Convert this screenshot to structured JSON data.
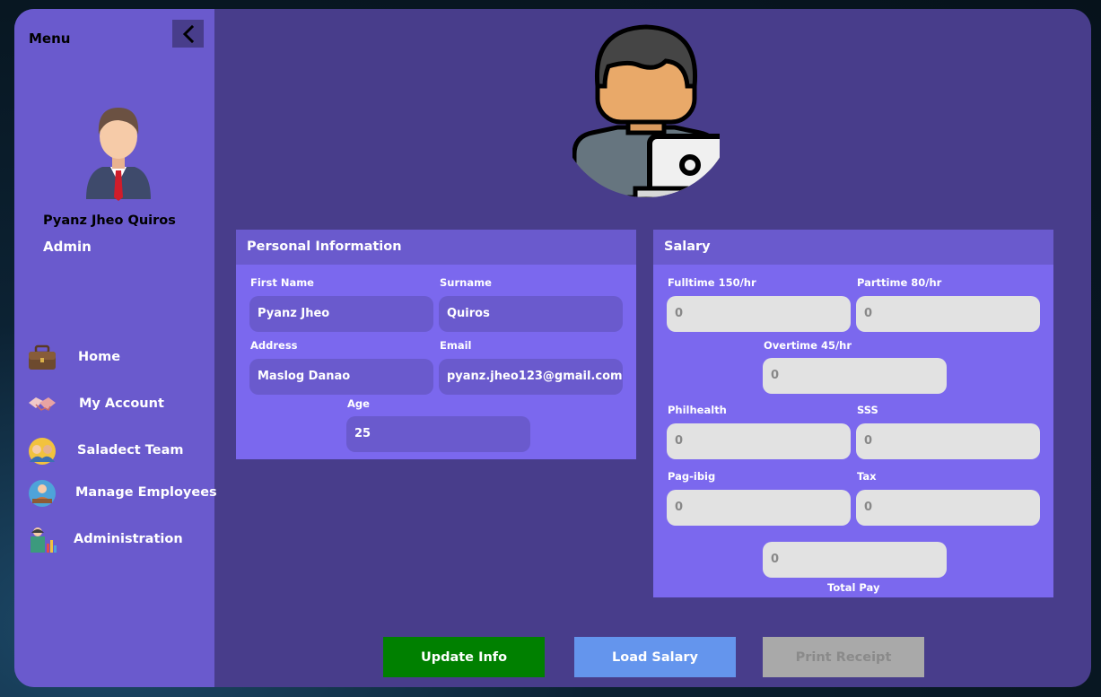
{
  "sidebar": {
    "menu_label": "Menu",
    "user_name": "Pyanz Jheo Quiros",
    "user_role": "Admin",
    "items": [
      {
        "label": "Home",
        "icon": "briefcase-icon"
      },
      {
        "label": "My Account",
        "icon": "handshake-icon"
      },
      {
        "label": "Saladect Team",
        "icon": "team-icon"
      },
      {
        "label": "Manage Employees",
        "icon": "employees-icon"
      },
      {
        "label": "Administration",
        "icon": "administration-icon"
      }
    ]
  },
  "personal": {
    "title": "Personal Information",
    "first_name_label": "First Name",
    "first_name": "Pyanz Jheo",
    "surname_label": "Surname",
    "surname": "Quiros",
    "address_label": "Address",
    "address": "Maslog Danao",
    "email_label": "Email",
    "email": "pyanz.jheo123@gmail.com",
    "age_label": "Age",
    "age": "25"
  },
  "salary": {
    "title": "Salary",
    "fulltime_label": "Fulltime 150/hr",
    "fulltime": "0",
    "parttime_label": "Parttime 80/hr",
    "parttime": "0",
    "overtime_label": "Overtime 45/hr",
    "overtime": "0",
    "philhealth_label": "Philhealth",
    "philhealth": "0",
    "sss_label": "SSS",
    "sss": "0",
    "pagibig_label": "Pag-ibig",
    "pagibig": "0",
    "tax_label": "Tax",
    "tax": "0",
    "total_pay": "0",
    "total_pay_label": "Total Pay"
  },
  "actions": {
    "update_label": "Update Info",
    "load_label": "Load Salary",
    "print_label": "Print Receipt"
  },
  "colors": {
    "sidebar": "#6a5acd",
    "main_bg": "#483d8b",
    "panel": "#7b68ee",
    "update_button": "#008000",
    "load_button": "#6495ed",
    "print_button_disabled": "#a9a9a9"
  }
}
